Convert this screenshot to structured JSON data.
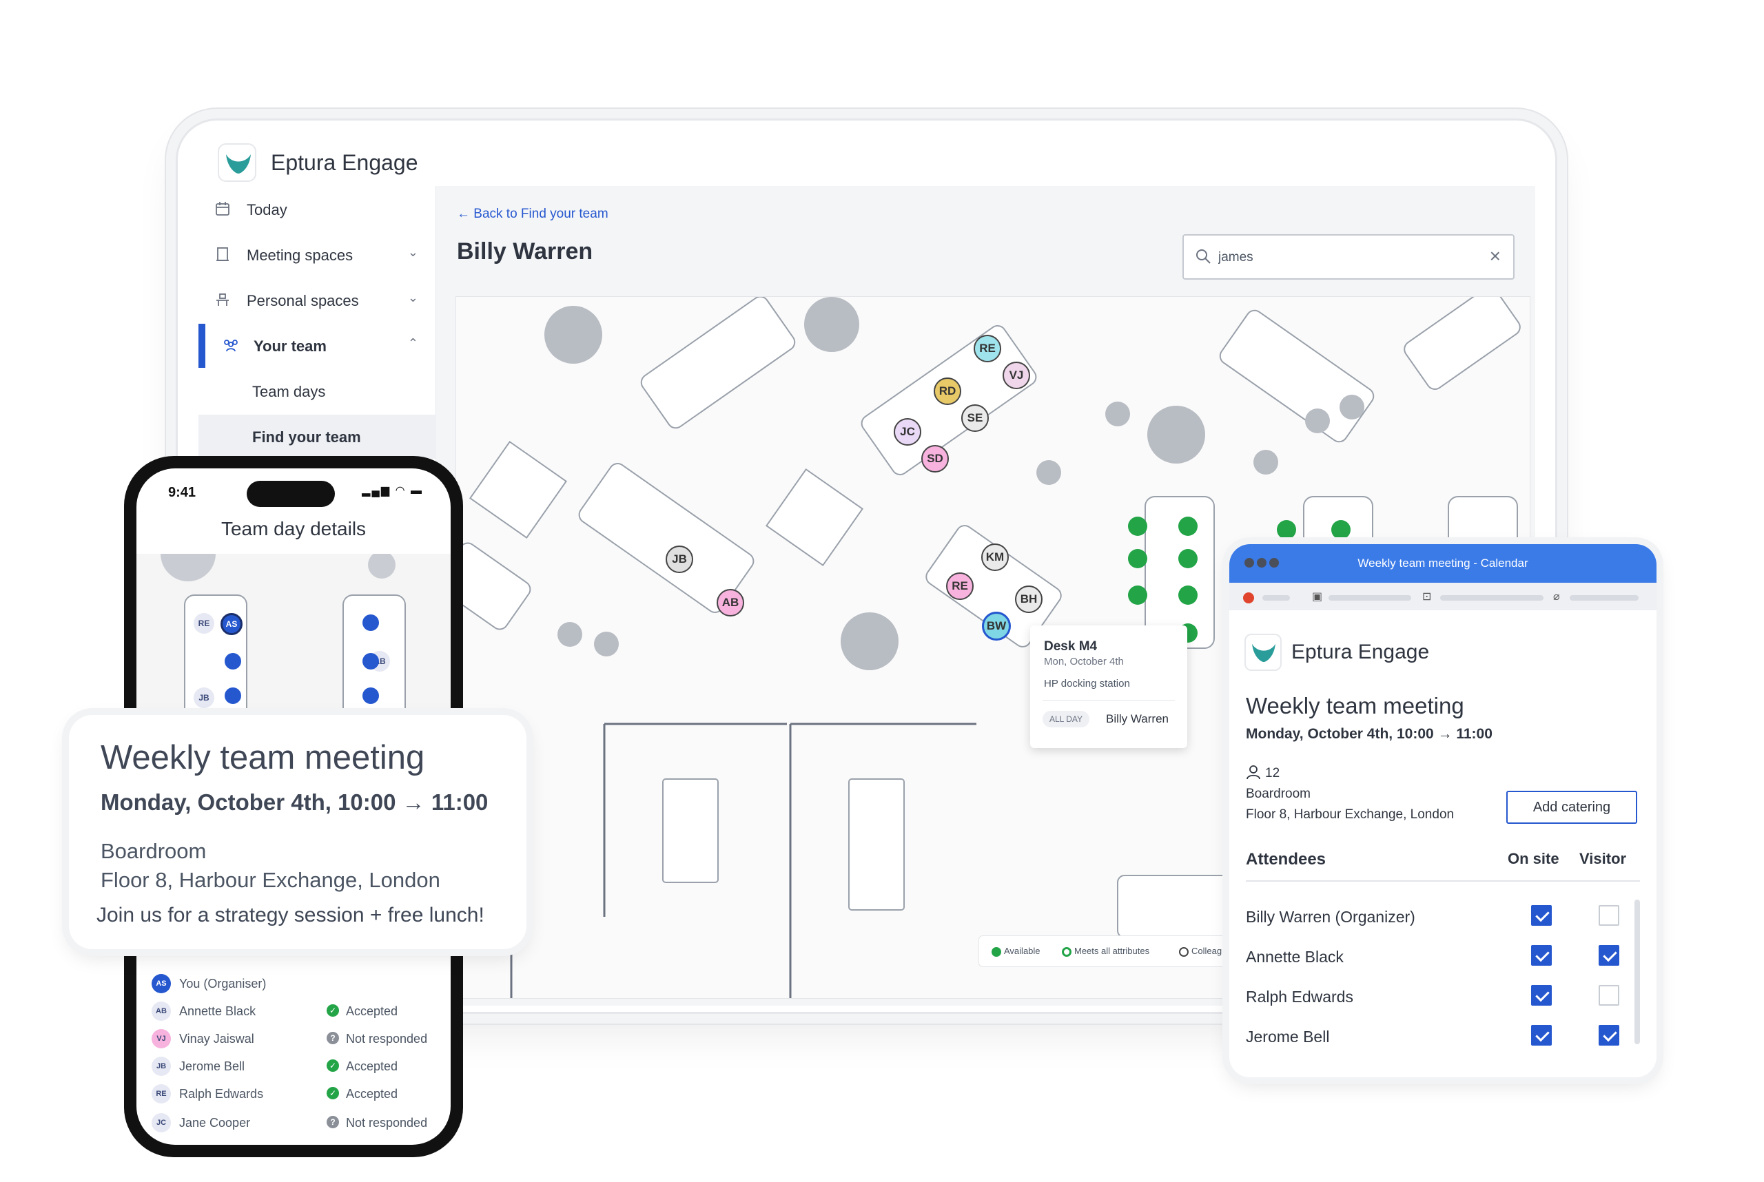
{
  "app": {
    "name": "Eptura Engage"
  },
  "sidebar": {
    "items": [
      {
        "label": "Today",
        "icon": "calendar-icon"
      },
      {
        "label": "Meeting spaces",
        "icon": "door-icon"
      },
      {
        "label": "Personal spaces",
        "icon": "desk-icon"
      },
      {
        "label": "Your team",
        "icon": "team-icon"
      },
      {
        "label": "Team days"
      },
      {
        "label": "Find your team"
      }
    ]
  },
  "main": {
    "back_link": "← Back to Find your team",
    "title": "Billy Warren",
    "search": {
      "value": "james"
    }
  },
  "floorplan": {
    "avatars": [
      "RE",
      "VJ",
      "RD",
      "SE",
      "JC",
      "SD",
      "JB",
      "AB",
      "KM",
      "RE",
      "BH",
      "BW"
    ],
    "legend": [
      "Available",
      "Meets all attributes",
      "Colleague"
    ]
  },
  "desk_card": {
    "title": "Desk M4",
    "date": "Mon, October 4th",
    "equipment": "HP docking station",
    "badge": "ALL DAY",
    "user": "Billy Warren"
  },
  "phone": {
    "time": "9:41",
    "title": "Team day details",
    "map_avatars": [
      "RE",
      "AS",
      "JB",
      "AB"
    ],
    "attendees": [
      {
        "initials": "AS",
        "name": "You (Organiser)",
        "status": ""
      },
      {
        "initials": "AB",
        "name": "Annette Black",
        "status": "Accepted"
      },
      {
        "initials": "VJ",
        "name": "Vinay Jaiswal",
        "status": "Not responded"
      },
      {
        "initials": "JB",
        "name": "Jerome Bell",
        "status": "Accepted"
      },
      {
        "initials": "RE",
        "name": "Ralph Edwards",
        "status": "Accepted"
      },
      {
        "initials": "JC",
        "name": "Jane Cooper",
        "status": "Not responded"
      }
    ]
  },
  "meeting_card": {
    "title": "Weekly team meeting",
    "time": "Monday, October 4th, 10:00 → 11:00",
    "room": "Boardroom",
    "address": "Floor 8, Harbour Exchange, London",
    "note": "Join us for a strategy session + free lunch!"
  },
  "calendar": {
    "window_title": "Weekly team meeting - Calendar",
    "brand": "Eptura Engage",
    "meeting_title": "Weekly team meeting",
    "time": "Monday, October 4th, 10:00 → 11:00",
    "count": "12",
    "room": "Boardroom",
    "address": "Floor 8, Harbour Exchange, London",
    "catering_button": "Add catering",
    "headers": {
      "attendees": "Attendees",
      "on_site": "On site",
      "visitor": "Visitor"
    },
    "rows": [
      {
        "name": "Billy Warren (Organizer)",
        "on_site": true,
        "visitor": false
      },
      {
        "name": "Annette Black",
        "on_site": true,
        "visitor": true
      },
      {
        "name": "Ralph Edwards",
        "on_site": true,
        "visitor": false
      },
      {
        "name": "Jerome Bell",
        "on_site": true,
        "visitor": true
      }
    ]
  },
  "colors": {
    "accent": "#2557cf",
    "brand": "#2a9d9b",
    "available": "#22a447",
    "titlebar": "#3b7be8"
  }
}
